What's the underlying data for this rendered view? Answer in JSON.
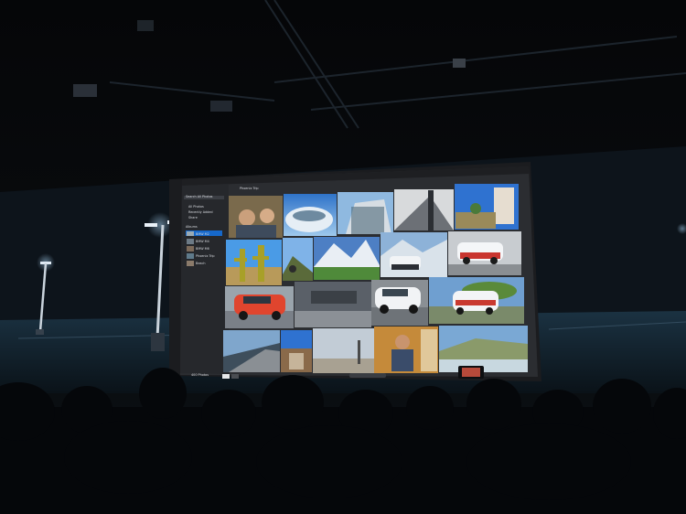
{
  "app": {
    "sidebar": {
      "search_placeholder": "Search All Photos",
      "items": [
        {
          "label": "All Photos",
          "icon": "photos-icon"
        },
        {
          "label": "Recently Added",
          "icon": "clock-icon"
        },
        {
          "label": "Share",
          "icon": "share-icon"
        }
      ],
      "section_label": "Albums",
      "albums": [
        {
          "label": "BMW M2",
          "icon": "album-icon"
        },
        {
          "label": "BMW M4",
          "icon": "album-icon"
        },
        {
          "label": "BMW M6",
          "icon": "album-icon"
        },
        {
          "label": "Phoenix Trip",
          "icon": "album-icon"
        },
        {
          "label": "Beach",
          "icon": "album-icon"
        }
      ]
    },
    "header": {
      "album_title": "Phoenix Trip",
      "icons": [
        "sort-icon",
        "share-icon",
        "settings-icon"
      ]
    },
    "footer": {
      "photo_count": "400 Photos",
      "view_icons": [
        "grid-view-icon",
        "detail-view-icon"
      ]
    },
    "colors": {
      "app_background": "#2b2d31",
      "sidebar": "#26282c",
      "accent": "#1473e6"
    }
  }
}
